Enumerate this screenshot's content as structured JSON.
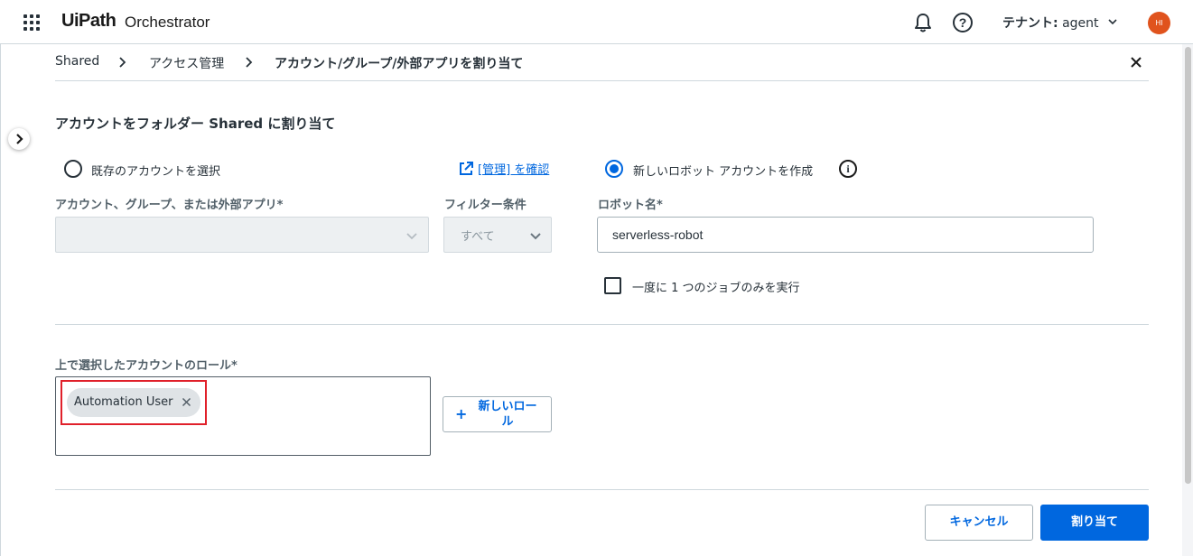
{
  "header": {
    "logo": "UiPath",
    "product": "Orchestrator",
    "tenant_label": "テナント:",
    "tenant_name": "agent",
    "avatar_initials": "HI"
  },
  "breadcrumb": {
    "items": [
      "Shared",
      "アクセス管理",
      "アカウント/グループ/外部アプリを割り当て"
    ]
  },
  "form": {
    "title": "アカウントをフォルダー Shared に割り当て",
    "radio_existing": "既存のアカウントを選択",
    "manage_link": "[管理] を確認",
    "radio_new": "新しいロボット アカウントを作成",
    "selected_option": "new",
    "account_label": "アカウント、グループ、または外部アプリ*",
    "account_value": "",
    "filter_label": "フィルター条件",
    "filter_value": "すべて",
    "robot_name_label": "ロボット名*",
    "robot_name_value": "serverless-robot",
    "single_job_label": "一度に 1 つのジョブのみを実行",
    "single_job_checked": false,
    "roles_label": "上で選択したアカウントのロール*",
    "roles": [
      "Automation User"
    ],
    "new_role_button": "新しいロール"
  },
  "footer": {
    "cancel": "キャンセル",
    "assign": "割り当て"
  },
  "colors": {
    "accent": "#0067df",
    "highlight": "#e0202a",
    "avatar": "#e0531d",
    "brand": "#fa4616"
  }
}
